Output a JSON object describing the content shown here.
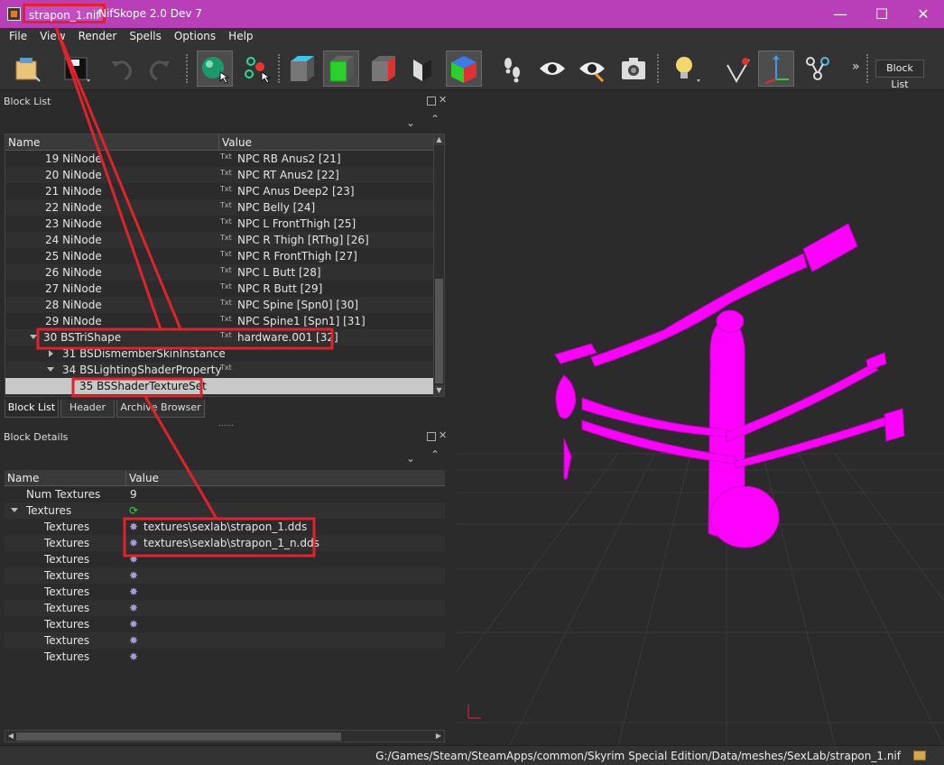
{
  "window": {
    "filename": "strapon_1.nif",
    "app_title": "NifSkope 2.0 Dev 7",
    "controls": {
      "minimize": "—",
      "maximize": "☐",
      "close": "✕"
    }
  },
  "menu": [
    "File",
    "View",
    "Render",
    "Spells",
    "Options",
    "Help"
  ],
  "toolbar": {
    "block_list_button": "Block List",
    "overflow": "»",
    "icons": [
      "load-icon",
      "save-icon",
      "undo-icon",
      "redo-icon",
      "select-object-icon",
      "select-vertex-icon",
      "view-top-icon",
      "view-front-icon",
      "view-side-icon",
      "view-walk-icon",
      "view-user-icon",
      "footprints-icon",
      "eye-icon",
      "eye-hide-icon",
      "screenshot-icon",
      "light-bulb-icon",
      "vertex-icon",
      "axes-icon",
      "nodes-icon"
    ]
  },
  "block_list": {
    "title": "Block List",
    "col_name": "Name",
    "col_value": "Value",
    "rows": [
      {
        "name": "19 NiNode",
        "value": "NPC RB Anus2 [21]",
        "badge": "Txt"
      },
      {
        "name": "20 NiNode",
        "value": "NPC RT Anus2 [22]",
        "badge": "Txt"
      },
      {
        "name": "21 NiNode",
        "value": "NPC Anus Deep2 [23]",
        "badge": "Txt"
      },
      {
        "name": "22 NiNode",
        "value": "NPC Belly [24]",
        "badge": "Txt"
      },
      {
        "name": "23 NiNode",
        "value": "NPC L FrontThigh [25]",
        "badge": "Txt"
      },
      {
        "name": "24 NiNode",
        "value": "NPC R Thigh [RThg] [26]",
        "badge": "Txt"
      },
      {
        "name": "25 NiNode",
        "value": "NPC R FrontThigh [27]",
        "badge": "Txt"
      },
      {
        "name": "26 NiNode",
        "value": "NPC L Butt [28]",
        "badge": "Txt"
      },
      {
        "name": "27 NiNode",
        "value": "NPC R Butt [29]",
        "badge": "Txt"
      },
      {
        "name": "28 NiNode",
        "value": "NPC Spine [Spn0] [30]",
        "badge": "Txt"
      },
      {
        "name": "29 NiNode",
        "value": "NPC Spine1 [Spn1] [31]",
        "badge": "Txt"
      },
      {
        "name": "30 BSTriShape",
        "value": "hardware.001 [32]",
        "badge": "Txt"
      },
      {
        "name": "31 BSDismemberSkinInstance",
        "value": "",
        "badge": ""
      },
      {
        "name": "34 BSLightingShaderProperty",
        "value": "",
        "badge": "Txt"
      },
      {
        "name": "35 BSShaderTextureSet",
        "value": "",
        "badge": ""
      }
    ],
    "tabs": [
      "Block List",
      "Header",
      "Archive Browser"
    ]
  },
  "block_details": {
    "title": "Block Details",
    "col_name": "Name",
    "col_value": "Value",
    "rows": [
      {
        "name": "Num Textures",
        "value": "9"
      },
      {
        "name": "Textures",
        "value": ""
      },
      {
        "name": "Textures",
        "value": "textures\\sexlab\\strapon_1.dds"
      },
      {
        "name": "Textures",
        "value": "textures\\sexlab\\strapon_1_n.dds"
      },
      {
        "name": "Textures",
        "value": ""
      },
      {
        "name": "Textures",
        "value": ""
      },
      {
        "name": "Textures",
        "value": ""
      },
      {
        "name": "Textures",
        "value": ""
      },
      {
        "name": "Textures",
        "value": ""
      },
      {
        "name": "Textures",
        "value": ""
      },
      {
        "name": "Textures",
        "value": ""
      }
    ]
  },
  "status": {
    "path": "G:/Games/Steam/SteamApps/common/Skyrim Special Edition/Data/meshes/SexLab/strapon_1.nif"
  },
  "colors": {
    "title_bar": "#b93fb9",
    "highlight": "#e0232b",
    "mesh": "#ff00ff"
  }
}
